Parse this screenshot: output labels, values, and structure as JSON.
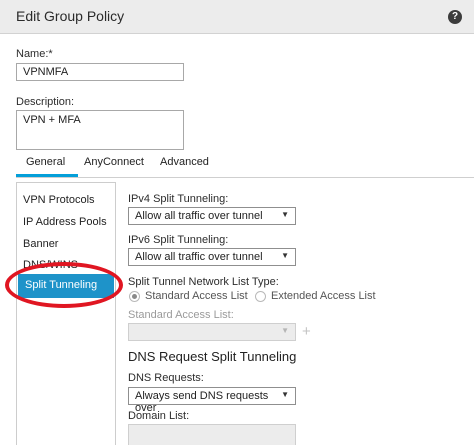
{
  "dialog": {
    "title": "Edit Group Policy",
    "help_icon": "?"
  },
  "name": {
    "label": "Name:*",
    "value": "VPNMFA"
  },
  "description": {
    "label": "Description:",
    "value": "VPN + MFA"
  },
  "tabs": [
    {
      "label": "General",
      "active": true
    },
    {
      "label": "AnyConnect",
      "active": false
    },
    {
      "label": "Advanced",
      "active": false
    }
  ],
  "nav": {
    "items": [
      {
        "label": "VPN Protocols"
      },
      {
        "label": "IP Address Pools"
      },
      {
        "label": "Banner"
      },
      {
        "label": "DNS/WINS"
      },
      {
        "label": "Split Tunneling",
        "selected": true
      }
    ]
  },
  "split": {
    "ipv4_label": "IPv4 Split Tunneling:",
    "ipv4_value": "Allow all traffic over tunnel",
    "ipv6_label": "IPv6 Split Tunneling:",
    "ipv6_value": "Allow all traffic over tunnel",
    "list_type_label": "Split Tunnel Network List Type:",
    "list_type_options": [
      "Standard Access List",
      "Extended Access List"
    ],
    "list_type_selected": "Standard Access List",
    "std_list_label": "Standard Access List:",
    "std_list_value": "",
    "add_icon": "+"
  },
  "dns": {
    "heading": "DNS Request Split Tunneling",
    "requests_label": "DNS Requests:",
    "requests_value": "Always send DNS requests over",
    "domain_label": "Domain List:",
    "domain_value": ""
  },
  "colors": {
    "accent": "#1e93c9",
    "highlight": "#e01622",
    "tab_underline": "#049fd9"
  }
}
